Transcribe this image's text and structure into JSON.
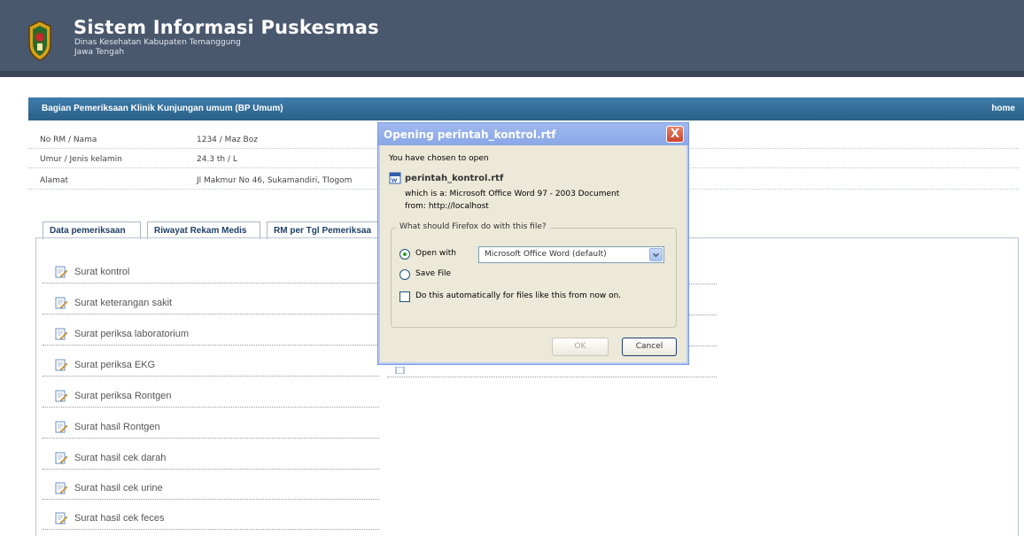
{
  "header": {
    "title": "Sistem Informasi Puskesmas",
    "subtitle1": "Dinas Kesehatan Kabupaten Temanggung",
    "subtitle2": "Jawa Tengah"
  },
  "section": {
    "title": "Bagian Pemeriksaan Klinik Kunjungan umum (BP Umum)",
    "home_link": "home"
  },
  "patient": [
    {
      "label": "No RM / Nama",
      "value": "1234 / Maz Boz"
    },
    {
      "label": "Umur / Jenis kelamin",
      "value": "24.3 th / L"
    },
    {
      "label": "Alamat",
      "value": "Jl Makmur No 46, Sukamandiri, Tlogom"
    }
  ],
  "tabs": [
    {
      "label": "Data pemeriksaan"
    },
    {
      "label": "Riwayat Rekam Medis"
    },
    {
      "label": "RM per Tgl Pemeriksaa"
    }
  ],
  "links": [
    {
      "label": "Surat kontrol"
    },
    {
      "label": "Surat keterangan sakit"
    },
    {
      "label": "Surat periksa laboratorium"
    },
    {
      "label": "Surat periksa EKG"
    },
    {
      "label": "Surat periksa Rontgen"
    },
    {
      "label": "Surat hasil Rontgen"
    },
    {
      "label": "Surat hasil cek darah"
    },
    {
      "label": "Surat hasil cek urine"
    },
    {
      "label": "Surat hasil cek feces"
    }
  ],
  "dialog": {
    "title": "Opening perintah_kontrol.rtf",
    "close_label": "X",
    "intro": "You have chosen to open",
    "file_name": "perintah_kontrol.rtf",
    "file_type": "which is a:  Microsoft Office Word 97 - 2003 Document",
    "file_from": "from:  http://localhost",
    "question": "What should Firefox do with this file?",
    "open_with_label": "Open with",
    "open_with_value": "Microsoft Office Word (default)",
    "save_file_label": "Save File",
    "auto_label": "Do this automatically for files like this from now on.",
    "ok_label": "OK",
    "cancel_label": "Cancel"
  },
  "colors": {
    "header_bg": "#4a586e",
    "section_bar": "#2f6a95",
    "dialog_title": "#8aa7e6",
    "dialog_close": "#c8452c"
  }
}
